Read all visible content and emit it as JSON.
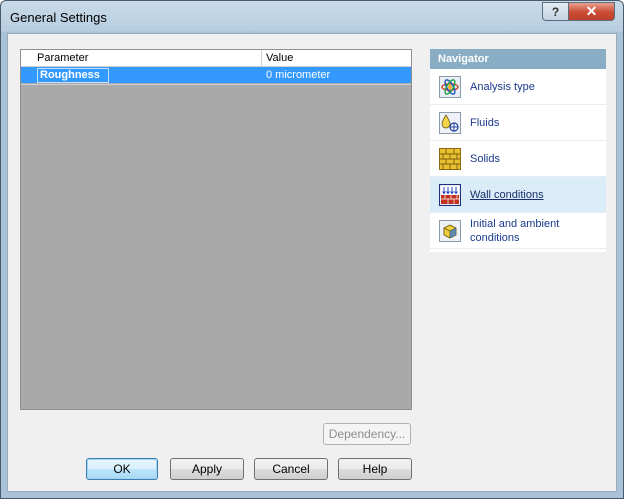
{
  "window": {
    "title": "General Settings",
    "help_glyph": "?",
    "close_glyph": "✕"
  },
  "grid": {
    "columns": [
      "Parameter",
      "Value"
    ],
    "rows": [
      {
        "parameter": "Roughness",
        "value": "0 micrometer"
      }
    ]
  },
  "navigator": {
    "header": "Navigator",
    "items": [
      {
        "label": "Analysis type",
        "icon": "analysis-type-icon",
        "selected": false
      },
      {
        "label": "Fluids",
        "icon": "fluids-icon",
        "selected": false
      },
      {
        "label": "Solids",
        "icon": "solids-icon",
        "selected": false
      },
      {
        "label": "Wall conditions",
        "icon": "wall-conditions-icon",
        "selected": true
      },
      {
        "label": "Initial and ambient conditions",
        "icon": "initial-conditions-icon",
        "selected": false
      }
    ]
  },
  "buttons": {
    "dependency": "Dependency...",
    "ok": "OK",
    "apply": "Apply",
    "cancel": "Cancel",
    "help": "Help"
  },
  "colors": {
    "selection": "#3399ff",
    "navigator_header": "#89adc4",
    "nav_selected": "#d9ecf8",
    "close_red": "#c94a33"
  }
}
